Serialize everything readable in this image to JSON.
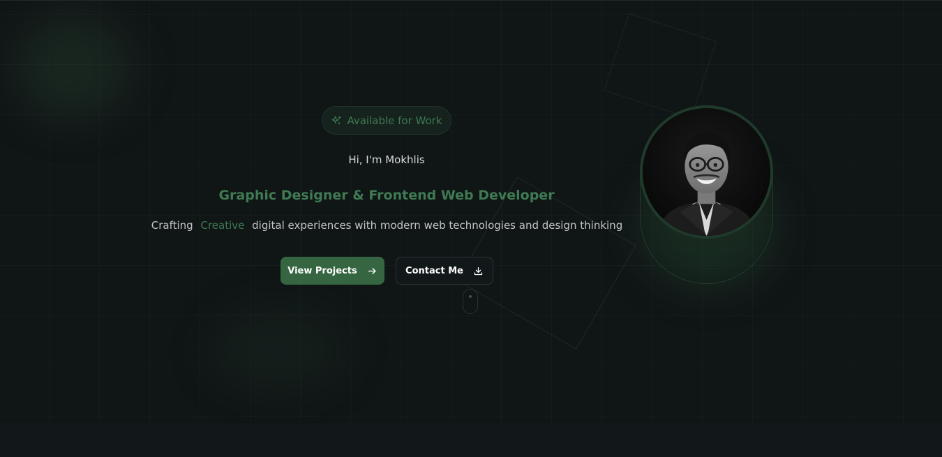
{
  "hero": {
    "badge": "Available for Work",
    "greeting": "Hi, I'm Mokhlis",
    "role": "Graphic Designer & Frontend Web Developer",
    "tagline_before": "Crafting",
    "tagline_accent": "Creative",
    "tagline_after": "digital experiences with modern web technologies and design thinking",
    "primary_button": "View Projects",
    "secondary_button": "Contact Me"
  },
  "icons": {
    "badge": "sparkles-icon",
    "primary_button": "arrow-right-icon",
    "secondary_button": "download-icon"
  },
  "colors": {
    "accent": "#3f7a52",
    "primary_button_bg": "#356641",
    "background": "#101516"
  }
}
